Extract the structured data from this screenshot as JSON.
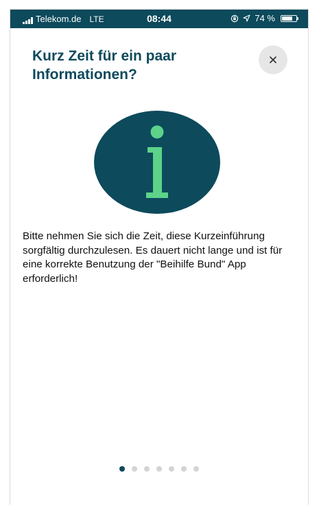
{
  "status_bar": {
    "carrier": "Telekom.de",
    "network": "LTE",
    "time": "08:44",
    "battery_percent": "74 %",
    "battery_level": 0.74,
    "icons": [
      "signal-icon",
      "rotation-lock-icon",
      "location-icon",
      "battery-icon"
    ]
  },
  "onboarding": {
    "title": "Kurz Zeit für ein paar Informationen?",
    "close_icon": "close-icon",
    "illustration_icon": "info-icon",
    "body": "Bitte nehmen Sie sich die Zeit, diese Kurzeinführung sorgfältig durchzulesen. Es dauert nicht lange und ist für eine korrekte Benutzung der \"Beihilfe Bund\" App erforderlich!"
  },
  "pager": {
    "total_pages": 7,
    "current_page": 1
  },
  "colors": {
    "primary": "#0d4a5c",
    "accent": "#5cd389",
    "close_bg": "#e6e6e6",
    "dot_inactive": "#d4d4d4"
  }
}
